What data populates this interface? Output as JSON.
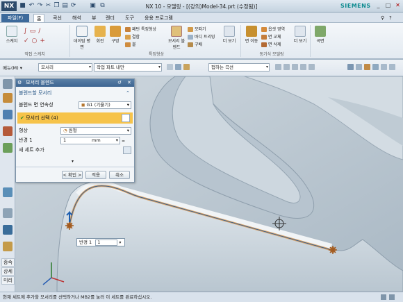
{
  "window": {
    "app": "NX",
    "title": "NX 10 - 모델링 - [(강의)Model-34.prt (수정됨)]",
    "brand": "SIEMENS"
  },
  "tabs": [
    "파일(F)",
    "홈",
    "곡선",
    "해석",
    "뷰",
    "렌더",
    "도구",
    "응용 프로그램"
  ],
  "ribbon": {
    "sketch": {
      "label": "스케치",
      "group": "직접 스케치"
    },
    "feature_buttons": [
      "데이텀 평면",
      "회전",
      "구멍"
    ],
    "small_items": [
      "패턴 특징형상",
      "결합",
      "블",
      "모따기",
      "바디 트리밍",
      "구배",
      "모서리 블렌드"
    ],
    "group_feature": "특징형상",
    "more1": "더 보기",
    "face": [
      "면 이동",
      "옵셋 영역",
      "면 교체",
      "면 삭제"
    ],
    "group_sync": "동기식 모델링",
    "more2": "더 보기",
    "surface": "곡면"
  },
  "toolbar2": {
    "menu": "메뉴(M)",
    "filter": "모서리",
    "scope": "작업 파트 내만",
    "curve_rule": "접하는 곡선"
  },
  "dialog": {
    "title": "모서리 블렌드",
    "section_edge": "블렌드할 모서리",
    "continuity_label": "블렌드 면 연속성",
    "continuity_value": "G1 (기울기)",
    "select_edge": "모서리 선택 (4)",
    "shape_label": "형상",
    "shape_value": "원형",
    "radius_label": "반경 1",
    "radius_value": "1",
    "radius_unit": "mm",
    "add_set": "새 세트 추가",
    "ok": "< 확인 >",
    "apply": "적용",
    "cancel": "취소"
  },
  "rail": [
    "종속",
    "상세",
    "미리"
  ],
  "viewport": {
    "radius_tag_label": "반경 1",
    "radius_tag_value": "1"
  },
  "status": "현재 세트에 추가할 모서리를 선택하거나 MB2를 눌러 이 세트를 완료하십시오.",
  "colors": {
    "titlebar": "#c5d3e0",
    "file_tab": "#3d6a9b",
    "dialog_head": "#3d6591",
    "selection": "#f6c34a",
    "edge": "#d9a46b",
    "brand": "#0a8a8f"
  }
}
